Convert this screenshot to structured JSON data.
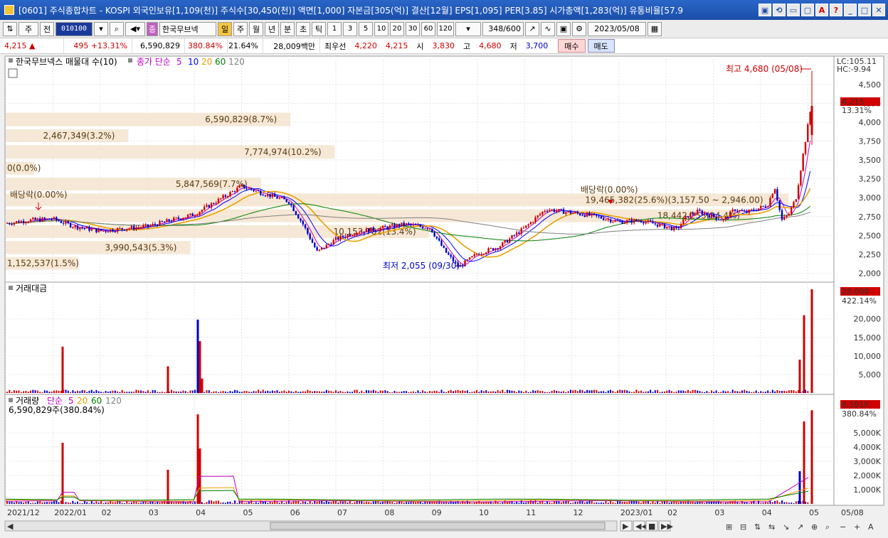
{
  "titlebar": {
    "title": "[0601] 주식종합차트 - KOSPI 외국인보유[1,109(천)] 주식수[30,450(천)] 액면[1,000] 자본금[305(억)] 결산[12월] EPS[1,095] PER[3.85] 시가총액[1,283(억)] 유통비율[57.9",
    "buttons": [
      "▣",
      "⟲",
      "▭",
      "▢",
      "A",
      "?",
      "_",
      "□",
      "✕"
    ]
  },
  "toolbar": {
    "market_select": "주",
    "prev_label": "전",
    "stock_code": "010100",
    "stock_name": "한국무브넥",
    "badge_label": "종",
    "periods": [
      "일",
      "주",
      "월",
      "년",
      "분",
      "초",
      "틱"
    ],
    "selected_period": "일",
    "intervals": [
      "1",
      "3",
      "5",
      "10",
      "20",
      "30",
      "60",
      "120"
    ],
    "count": "348",
    "count_total": "/600",
    "date": "2023/05/08"
  },
  "quote": {
    "price": "4,215 ▲",
    "change": "495 +13.31%",
    "volume": "6,590,829",
    "volume_ratio": "380.84%",
    "turnover": "21.64%",
    "amount": "28,009백만",
    "best_bid_label": "최우선",
    "best_ask": "4,220",
    "best_bid": "4,215",
    "open_label": "시",
    "open": "3,830",
    "high_label": "고",
    "high": "4,680",
    "low_label": "저",
    "low": "3,700",
    "buy_label": "매수",
    "sell_label": "매도"
  },
  "price_panel": {
    "legend_title": "한국무브넥스 매물대 수(10)",
    "ma_legend": "종가 단순",
    "ma_periods": [
      "5",
      "10",
      "20",
      "60",
      "120"
    ],
    "ma_colors": [
      "#c000c0",
      "#0000ff",
      "#e8a000",
      "#008000",
      "#808080"
    ],
    "lc_label": "LC:105.11",
    "hc_label": "HC:-9.94",
    "current_price": "4,215",
    "current_change": "13.31%",
    "high_annotation": "최고 4,680 (05/08)",
    "low_annotation": "최저 2,055 (09/30)",
    "dividend_label": "배당락(0.00%)"
  },
  "amount_panel": {
    "legend_title": "거래대금",
    "current_value": "28,009",
    "current_ratio": "422.14%"
  },
  "volume_panel": {
    "legend_title": "거래량",
    "ma_legend": "단순",
    "ma_periods": [
      "5",
      "20",
      "60",
      "120"
    ],
    "current_line": "6,590,829주(380.84%)",
    "current_value": "6,591K",
    "current_ratio": "380.84%"
  },
  "chart_data": {
    "type": "candlestick",
    "price_axis": {
      "ticks": [
        2000,
        2250,
        2500,
        2750,
        3000,
        3250,
        3500,
        3750,
        4000,
        4250,
        4500
      ],
      "range": [
        1920,
        4780
      ]
    },
    "amount_axis": {
      "ticks": [
        "5,000",
        "10,000",
        "15,000",
        "20,000"
      ],
      "range": [
        0,
        28000
      ]
    },
    "volume_axis": {
      "ticks": [
        "1,000K",
        "2,000K",
        "3,000K",
        "4,000K",
        "5,000K"
      ],
      "range": [
        0,
        6800
      ]
    },
    "x_labels": [
      "2021/12",
      "2022/01",
      "02",
      "03",
      "04",
      "05",
      "06",
      "07",
      "08",
      "09",
      "10",
      "11",
      "12",
      "2023/01",
      "02",
      "03",
      "04",
      "05",
      "05/08"
    ],
    "price_path": [
      [
        "2021/12",
        2660
      ],
      [
        "2021/12",
        2700
      ],
      [
        "2022/01",
        2720
      ],
      [
        "2022/01",
        2620
      ],
      [
        "02",
        2560
      ],
      [
        "02",
        2580
      ],
      [
        "03",
        2620
      ],
      [
        "03",
        2700
      ],
      [
        "04",
        2780
      ],
      [
        "04",
        2900
      ],
      [
        "04",
        3150
      ],
      [
        "05",
        3150
      ],
      [
        "05",
        3050
      ],
      [
        "06",
        2950
      ],
      [
        "06",
        2650
      ],
      [
        "06",
        2280
      ],
      [
        "07",
        2450
      ],
      [
        "07",
        2550
      ],
      [
        "08",
        2600
      ],
      [
        "08",
        2650
      ],
      [
        "09",
        2600
      ],
      [
        "09",
        2300
      ],
      [
        "09",
        2080
      ],
      [
        "10",
        2260
      ],
      [
        "10",
        2350
      ],
      [
        "11",
        2600
      ],
      [
        "11",
        2850
      ],
      [
        "12",
        2800
      ],
      [
        "12",
        2760
      ],
      [
        "2023/01",
        2680
      ],
      [
        "2023/01",
        2700
      ],
      [
        "02",
        2760
      ],
      [
        "02",
        2820
      ],
      [
        "03",
        2850
      ],
      [
        "03",
        2800
      ],
      [
        "04",
        2700
      ],
      [
        "04",
        2780
      ],
      [
        "04",
        3000
      ],
      [
        "05",
        3400
      ],
      [
        "05",
        3800
      ],
      [
        "05/08",
        4215
      ]
    ],
    "volume_profile": [
      {
        "label": "6,590,829(8.7%)",
        "price_high": 4140,
        "price_low": 3930,
        "share": 8.7
      },
      {
        "label": "2,467,349(3.2%)",
        "price_high": 3920,
        "price_low": 3720,
        "share": 3.2
      },
      {
        "label": "7,774,974(10.2%)",
        "price_high": 3710,
        "price_low": 3500,
        "share": 10.2
      },
      {
        "label": "0(0.0%)",
        "price_high": 3490,
        "price_low": 3290,
        "share": 0.0
      },
      {
        "label": "5,847,569(7.7%)",
        "price_high": 3280,
        "price_low": 3080,
        "share": 7.7
      },
      {
        "label": "19,465,382(25.6%)(3,157.50 ~ 2,946.00)",
        "price_high": 3070,
        "price_low": 2870,
        "share": 25.6
      },
      {
        "label": "18,442,253(24.4%)",
        "price_high": 2860,
        "price_low": 2660,
        "share": 24.4
      },
      {
        "label": "10,153,782(13.4%)",
        "price_high": 2650,
        "price_low": 2450,
        "share": 13.4
      },
      {
        "label": "3,990,543(5.3%)",
        "price_high": 2440,
        "price_low": 2240,
        "share": 5.3
      },
      {
        "label": "1,152,537(1.5%)",
        "price_high": 2230,
        "price_low": 2030,
        "share": 1.5
      }
    ],
    "amount_spikes": [
      {
        "x": "2022/01",
        "value": 12500,
        "dir": "up"
      },
      {
        "x": "03",
        "value": 7200,
        "dir": "up"
      },
      {
        "x": "04",
        "value": 19800,
        "dir": "down"
      },
      {
        "x": "04",
        "value": 14000,
        "dir": "up"
      },
      {
        "x": "04",
        "value": 3900,
        "dir": "up"
      },
      {
        "x": "05",
        "value": 21000,
        "dir": "up"
      },
      {
        "x": "05",
        "value": 9000,
        "dir": "up"
      },
      {
        "x": "05/08",
        "value": 28009,
        "dir": "up"
      }
    ],
    "volume_spikes": [
      {
        "x": "2022/01",
        "value": 4300,
        "dir": "up"
      },
      {
        "x": "03",
        "value": 2400,
        "dir": "up"
      },
      {
        "x": "04",
        "value": 6300,
        "dir": "up"
      },
      {
        "x": "04",
        "value": 3900,
        "dir": "up"
      },
      {
        "x": "05",
        "value": 5800,
        "dir": "up"
      },
      {
        "x": "05",
        "value": 2300,
        "dir": "down"
      },
      {
        "x": "05/08",
        "value": 6591,
        "dir": "up"
      }
    ]
  }
}
